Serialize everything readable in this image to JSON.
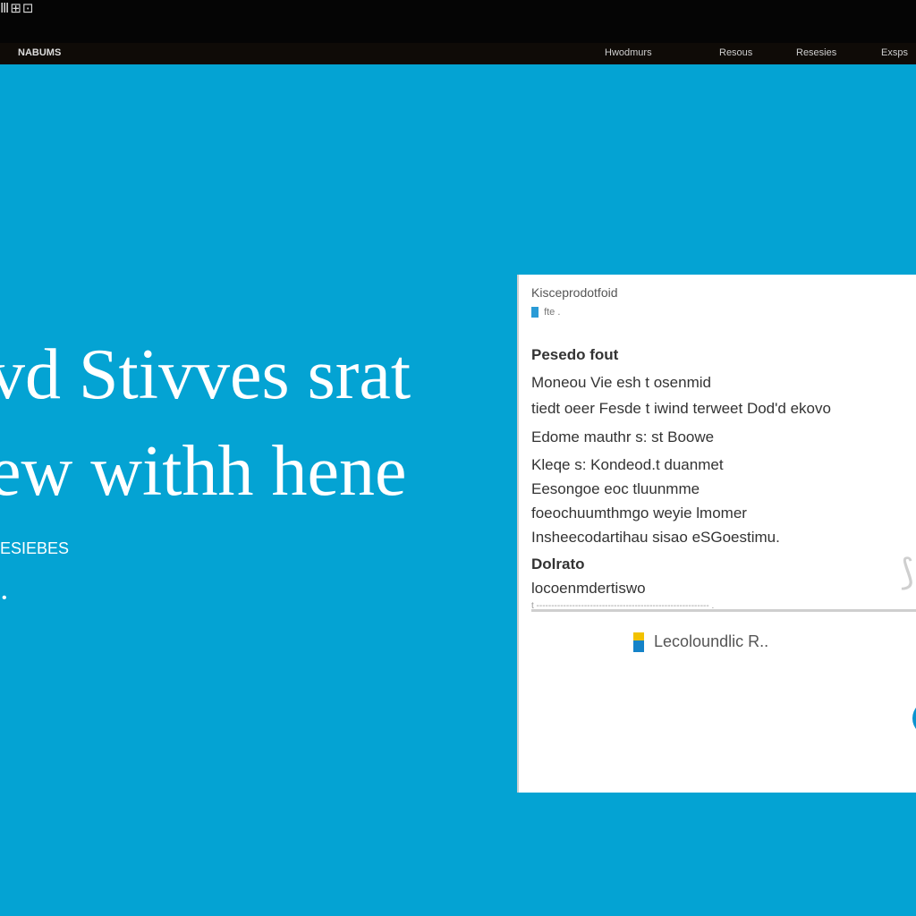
{
  "topbar": {
    "brand": "Ⅲ⊞⊡"
  },
  "navbar": {
    "logo": "NABUMS",
    "items": [
      "Hwodmurs",
      "Resous",
      "Resesies",
      "Exsps"
    ]
  },
  "hero": {
    "headline_lines": [
      "vd Stivves srat",
      "ew withh hene"
    ],
    "sub_text": "ESIEBES",
    "dot": "•"
  },
  "panel": {
    "header": "Kisceprodotfoid",
    "meta": "fte .",
    "lines": [
      {
        "text": "Pesedo fout",
        "bold": true
      },
      {
        "text": "Moneou Vie esh t osenmid",
        "bold": false
      },
      {
        "text": "tiedt oeer  Fesde t iwind  terweet  Dod'd ekovo",
        "bold": false
      },
      {
        "text": "Edome mauthr s: st Boowe",
        "bold": false
      },
      {
        "text": "Kleqe s: Kondeod.t duanmet",
        "bold": false
      },
      {
        "text": "Eesongoe eoc  tluunmme",
        "bold": false
      },
      {
        "text": "foeochuumthmgo weyie lmomer",
        "bold": false
      },
      {
        "text": "Insheecodartihau sisao eSGoestimu.",
        "bold": false
      },
      {
        "text": "Dolrato",
        "bold": true
      },
      {
        "text": "locoenmdertiswo",
        "bold": false
      }
    ],
    "divider_text": "t ---------------------------------------------------------- .",
    "link": "Lecoloundlic R..",
    "corner_glyph": "⟆"
  }
}
